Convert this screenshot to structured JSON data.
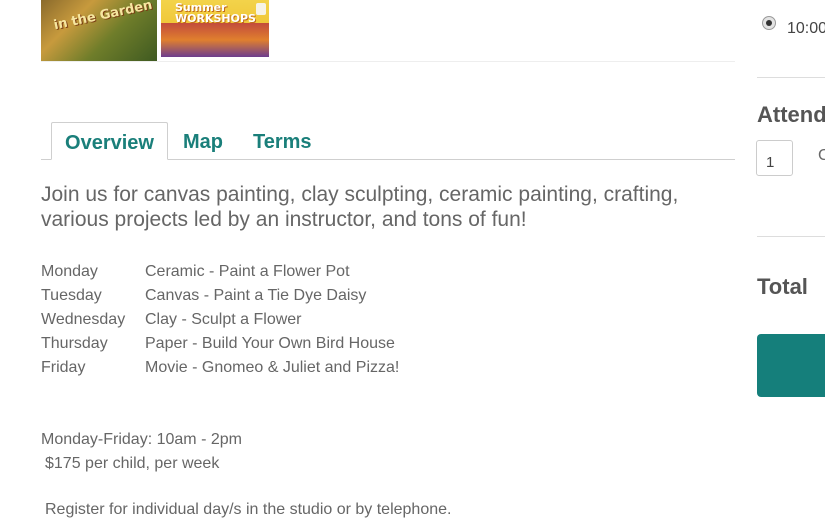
{
  "thumbnails": [
    {
      "text": "in the Garden",
      "icon": "garden-image"
    },
    {
      "text": "Summer WORKSHOPS",
      "icon": "workshops-image"
    }
  ],
  "tabs": [
    {
      "label": "Overview",
      "active": true
    },
    {
      "label": "Map",
      "active": false
    },
    {
      "label": "Terms",
      "active": false
    }
  ],
  "overview": {
    "intro": "Join us for canvas painting, clay sculpting, ceramic painting, crafting, various projects led by an instructor, and tons of fun!",
    "schedule": [
      {
        "day": "Monday",
        "activity": "Ceramic - Paint a Flower Pot"
      },
      {
        "day": "Tuesday",
        "activity": "Canvas - Paint a Tie Dye Daisy"
      },
      {
        "day": "Wednesday",
        "activity": "Clay - Sculpt a Flower"
      },
      {
        "day": "Thursday",
        "activity": "Paper - Build Your Own Bird House"
      },
      {
        "day": "Friday",
        "activity": "Movie - Gnomeo & Juliet and Pizza!"
      }
    ],
    "hours": "Monday-Friday: 10am - 2pm",
    "price": "$175 per child, per week",
    "register": "Register for individual day/s in the studio or by telephone."
  },
  "sidebar": {
    "time_option": "10:00",
    "attend_heading": "Attend",
    "quantity_value": "1",
    "quantity_suffix": "C",
    "total_label": "Total"
  },
  "colors": {
    "accent": "#1a7f7a",
    "button": "#157f7b",
    "text": "#666666"
  }
}
